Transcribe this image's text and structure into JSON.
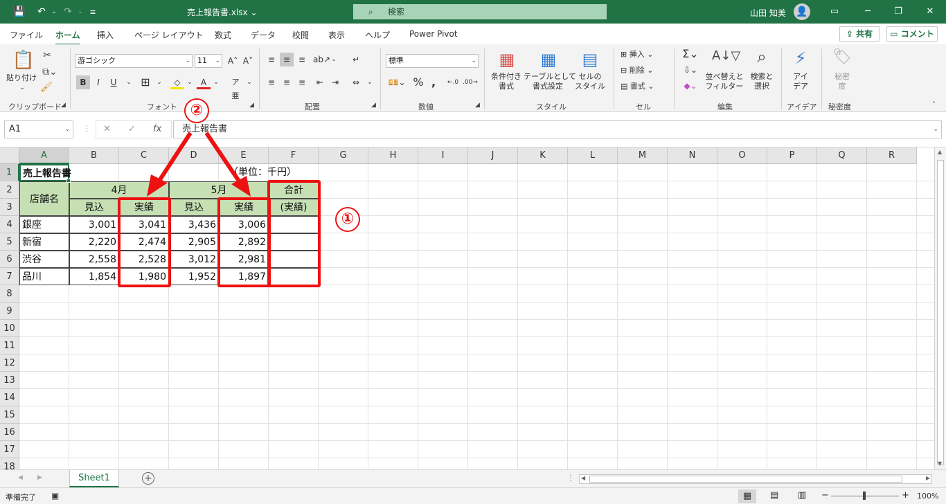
{
  "titlebar": {
    "filename": "売上報告書.xlsx",
    "filename_caret": "⌄",
    "search_placeholder": "検索",
    "user_name": "山田 知美"
  },
  "ribbon_tabs": [
    "ファイル",
    "ホーム",
    "挿入",
    "ページ レイアウト",
    "数式",
    "データ",
    "校閲",
    "表示",
    "ヘルプ",
    "Power Pivot"
  ],
  "share_label": "共有",
  "comment_label": "コメント",
  "ribbon": {
    "clipboard": {
      "paste": "貼り付け",
      "label": "クリップボード"
    },
    "font": {
      "font_name": "游ゴシック",
      "font_size": "11",
      "bold": "B",
      "italic": "I",
      "underline": "U",
      "label": "フォント"
    },
    "alignment": {
      "label": "配置"
    },
    "number": {
      "format": "標準",
      "label": "数値"
    },
    "styles": {
      "conditional": "条件付き\n書式",
      "table": "テーブルとして\n書式設定",
      "cell_style": "セルの\nスタイル",
      "label": "スタイル"
    },
    "cells": {
      "insert": "挿入",
      "delete": "削除",
      "format": "書式",
      "label": "セル"
    },
    "editing": {
      "sort": "並べ替えと\nフィルター",
      "find": "検索と\n選択",
      "label": "編集"
    },
    "ideas": {
      "ideas": "アイ\nデア",
      "label": "アイデア"
    },
    "sensitivity": {
      "label_btn": "秘密\n度",
      "label": "秘密度"
    }
  },
  "formula_bar": {
    "name_box": "A1",
    "formula": "売上報告書"
  },
  "columns": [
    "A",
    "B",
    "C",
    "D",
    "E",
    "F",
    "G",
    "H",
    "I",
    "J",
    "K",
    "L",
    "M",
    "N",
    "O",
    "P",
    "Q",
    "R"
  ],
  "rows": [
    "1",
    "2",
    "3",
    "4",
    "5",
    "6",
    "7",
    "8",
    "9",
    "10",
    "11",
    "12",
    "13",
    "14",
    "15",
    "16",
    "17",
    "18"
  ],
  "sheet": {
    "title": "売上報告書",
    "unit": "（単位：千円）",
    "store_header": "店舗名",
    "april": "4月",
    "may": "5月",
    "total": "合計",
    "total_sub": "(実績)",
    "plan": "見込",
    "actual": "実績",
    "data": [
      {
        "store": "銀座",
        "apr_plan": "3,001",
        "apr_actual": "3,041",
        "may_plan": "3,436",
        "may_actual": "3,006"
      },
      {
        "store": "新宿",
        "apr_plan": "2,220",
        "apr_actual": "2,474",
        "may_plan": "2,905",
        "may_actual": "2,892"
      },
      {
        "store": "渋谷",
        "apr_plan": "2,558",
        "apr_actual": "2,528",
        "may_plan": "3,012",
        "may_actual": "2,981"
      },
      {
        "store": "品川",
        "apr_plan": "1,854",
        "apr_actual": "1,980",
        "may_plan": "1,952",
        "may_actual": "1,897"
      }
    ]
  },
  "annotations": {
    "one": "①",
    "two": "②",
    "accent": "#ee1111"
  },
  "sheet_tab": "Sheet1",
  "status": {
    "ready": "準備完了",
    "zoom": "100%"
  }
}
